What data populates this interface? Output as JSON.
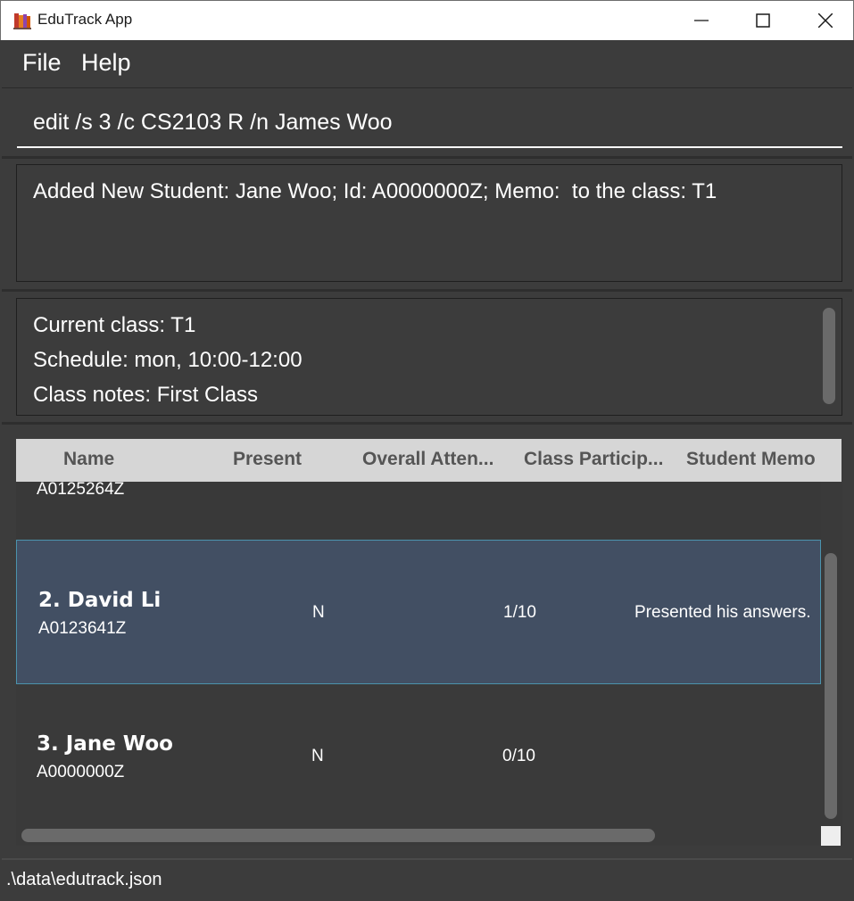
{
  "window": {
    "title": "EduTrack App",
    "icon": "app-books-icon"
  },
  "menu": {
    "file_label": "File",
    "help_label": "Help"
  },
  "command": {
    "value": "edit /s 3 /c CS2103 R /n James Woo"
  },
  "result": {
    "text": "Added New Student: Jane Woo; Id: A0000000Z; Memo:  to the class: T1"
  },
  "class_info": {
    "current_class": "Current class: T1",
    "schedule": "Schedule: mon, 10:00-12:00",
    "notes": "Class notes: First Class"
  },
  "table": {
    "columns": [
      "Name",
      "Present",
      "Overall Atten...",
      "Class Particip...",
      "Student Memo"
    ],
    "partial_row": {
      "id": "A0125264Z"
    },
    "rows": [
      {
        "index_name": "2.  David Li",
        "id": "A0123641Z",
        "present": "N",
        "participation": "1/10",
        "memo": "Presented his answers.",
        "selected": true
      },
      {
        "index_name": "3.  Jane Woo",
        "id": "A0000000Z",
        "present": "N",
        "participation": "0/10",
        "memo": "",
        "selected": false
      }
    ]
  },
  "status": {
    "file_path": ".\\data\\edutrack.json"
  },
  "colors": {
    "background": "#3c3c3c",
    "header_bg": "#d6d6d6",
    "selected_row": "#424f63",
    "selected_border": "#4b93ad"
  }
}
